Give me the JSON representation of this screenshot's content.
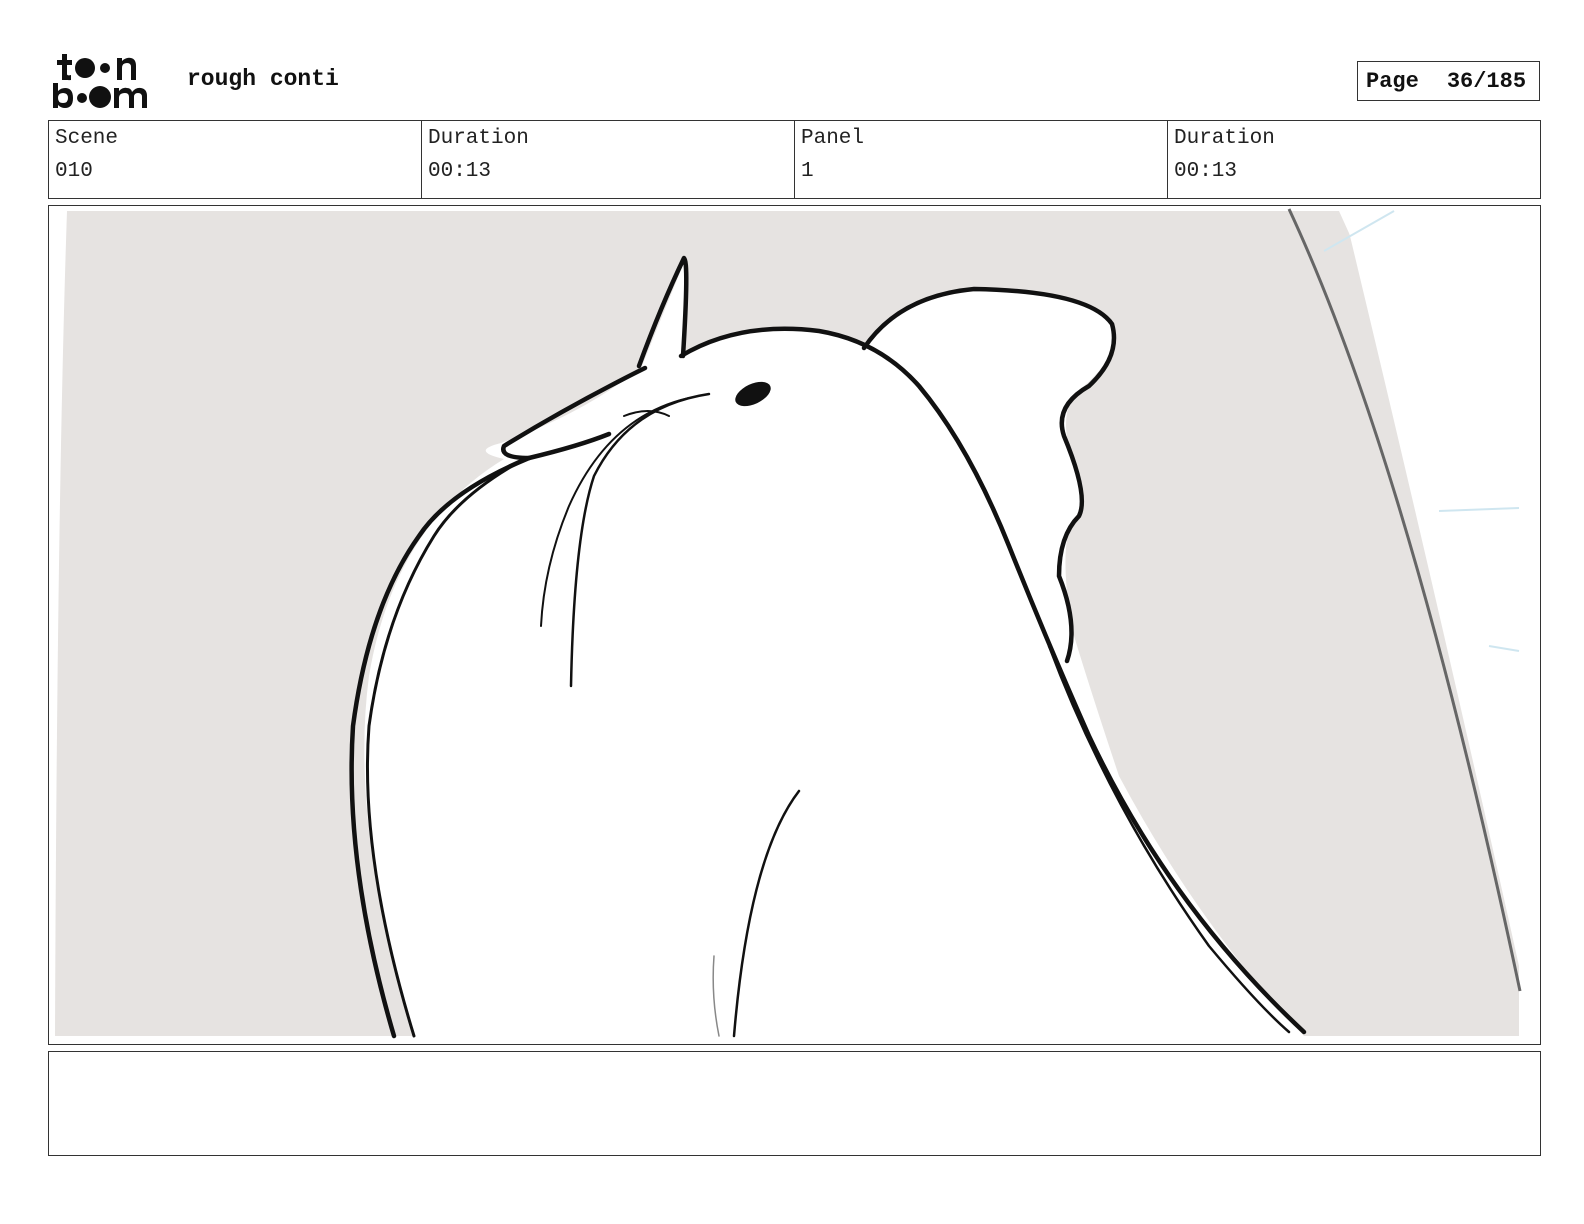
{
  "header": {
    "logo_text": "toon boom",
    "project_title": "rough conti",
    "page_label": "Page",
    "page_number": "36/185"
  },
  "info": {
    "scene_label": "Scene",
    "scene_value": "010",
    "scene_duration_label": "Duration",
    "scene_duration_value": "00:13",
    "panel_label": "Panel",
    "panel_value": "1",
    "panel_duration_label": "Duration",
    "panel_duration_value": "00:13"
  },
  "panel_art": {
    "subject": "rough sketch of a bird seen from below",
    "background_color": "#e6e3e1",
    "line_color": "#111111"
  },
  "notes": {
    "text": ""
  }
}
